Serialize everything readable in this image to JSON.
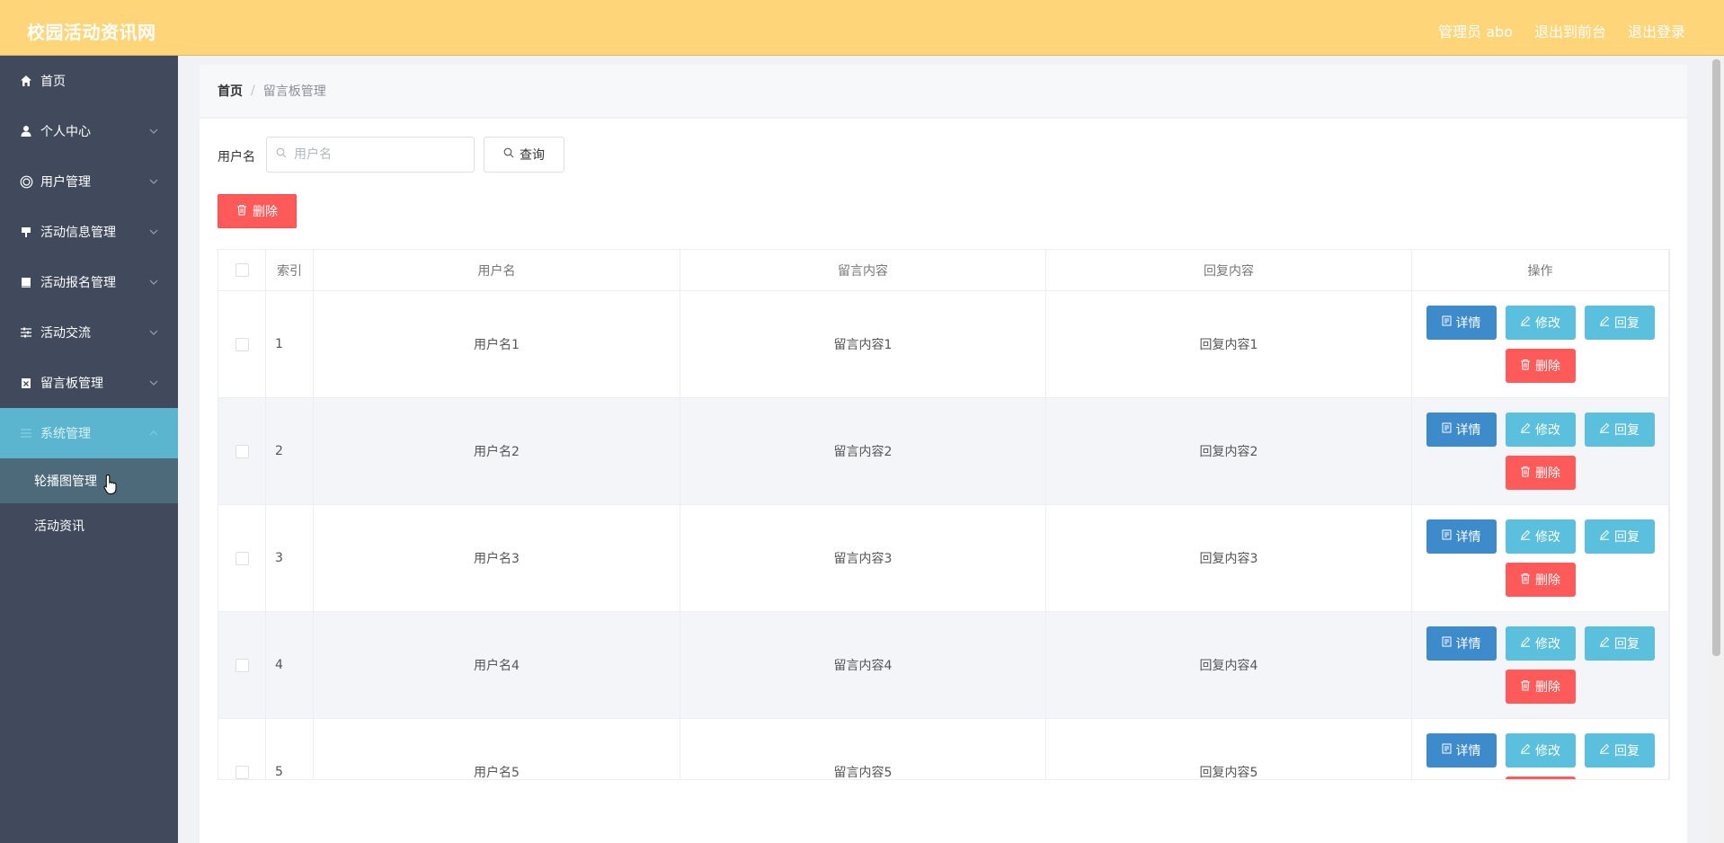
{
  "header": {
    "brand": "校园活动资讯网",
    "links": [
      "管理员 abo",
      "退出到前台",
      "退出登录"
    ]
  },
  "sidebar": {
    "items": [
      {
        "label": "首页",
        "icon": "home-icon",
        "has_children": false
      },
      {
        "label": "个人中心",
        "icon": "user-icon",
        "has_children": true
      },
      {
        "label": "用户管理",
        "icon": "user-circle-icon",
        "has_children": true
      },
      {
        "label": "活动信息管理",
        "icon": "post-icon",
        "has_children": true
      },
      {
        "label": "活动报名管理",
        "icon": "document-icon",
        "has_children": true
      },
      {
        "label": "活动交流",
        "icon": "sliders-icon",
        "has_children": true
      },
      {
        "label": "留言板管理",
        "icon": "clipboard-icon",
        "has_children": true
      },
      {
        "label": "系统管理",
        "icon": "menu-icon",
        "has_children": true,
        "active": true
      }
    ],
    "sub_items": [
      {
        "label": "轮播图管理",
        "selected": true
      },
      {
        "label": "活动资讯",
        "selected": false
      }
    ]
  },
  "breadcrumb": {
    "home": "首页",
    "separator": "/",
    "current": "留言板管理"
  },
  "search": {
    "label": "用户名",
    "placeholder": "用户名",
    "value": "",
    "button_label": "查询"
  },
  "toolbar": {
    "delete_label": "删除"
  },
  "table": {
    "columns": [
      "索引",
      "用户名",
      "留言内容",
      "回复内容",
      "操作"
    ],
    "rows": [
      {
        "index": "1",
        "username": "用户名1",
        "message": "留言内容1",
        "reply": "回复内容1"
      },
      {
        "index": "2",
        "username": "用户名2",
        "message": "留言内容2",
        "reply": "回复内容2"
      },
      {
        "index": "3",
        "username": "用户名3",
        "message": "留言内容3",
        "reply": "回复内容3"
      },
      {
        "index": "4",
        "username": "用户名4",
        "message": "留言内容4",
        "reply": "回复内容4"
      },
      {
        "index": "5",
        "username": "用户名5",
        "message": "留言内容5",
        "reply": "回复内容5"
      }
    ],
    "actions": {
      "detail": "详情",
      "edit": "修改",
      "reply": "回复",
      "delete": "删除"
    }
  },
  "colors": {
    "header_bg": "#ffd57a",
    "sidebar_bg": "#414a5c",
    "sidebar_active": "#5bb5cf",
    "detail_btn": "#3d8bcb",
    "edit_btn": "#5bc0de",
    "delete_btn": "#ff5a5a"
  }
}
